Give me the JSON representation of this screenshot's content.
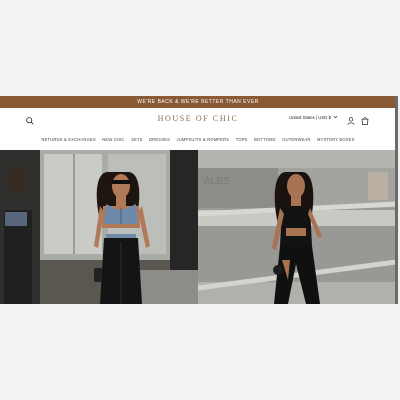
{
  "announcement": {
    "text": "WE'RE BACK & WE'RE BETTER THAN EVER"
  },
  "header": {
    "logo": "HOUSE OF CHIC",
    "currency": "United States | USD $",
    "icons": {
      "search": "search-icon",
      "account": "account-icon",
      "cart": "cart-icon",
      "currency_toggle": "chevron-down-icon"
    }
  },
  "nav": {
    "items": [
      {
        "label": "RETURNS & EXCHANGES"
      },
      {
        "label": "NEW CHIC"
      },
      {
        "label": "SETS"
      },
      {
        "label": "DRESSES"
      },
      {
        "label": "JUMPSUITS & ROMPERS"
      },
      {
        "label": "TOPS"
      },
      {
        "label": "BOTTOMS"
      },
      {
        "label": "OUTERWEAR"
      },
      {
        "label": "MYSTERY BOXES"
      }
    ]
  },
  "hero": {
    "images": [
      "model-denim-top-cargo-pants",
      "model-black-cutout-jumpsuit"
    ]
  },
  "colors": {
    "announcement_bg": "#8a5a35",
    "logo": "#8a6a4a",
    "page_bg": "#f2f2f2"
  }
}
